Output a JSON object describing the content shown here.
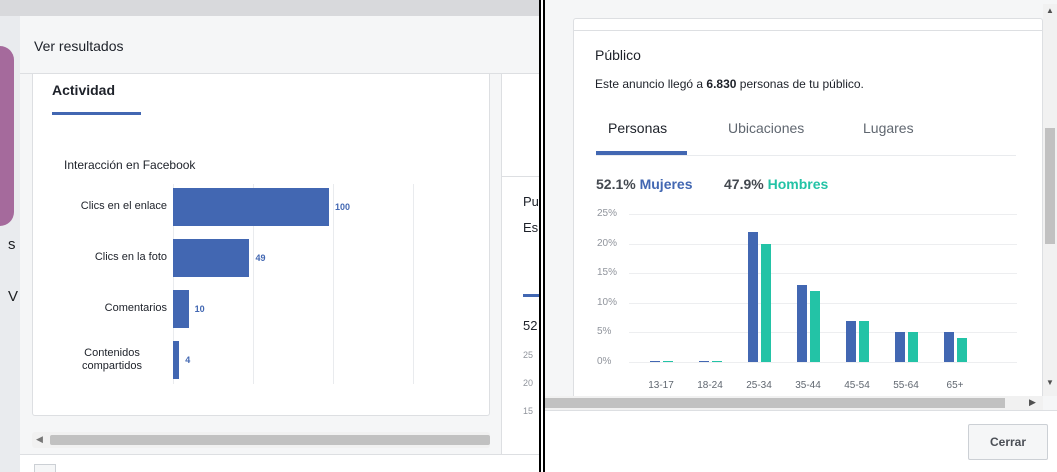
{
  "left": {
    "modal_title": "Ver resultados",
    "tab_label": "Actividad",
    "peek_letters": [
      "s",
      "V",
      "Pu",
      "Es",
      "52",
      "25",
      "20",
      "15"
    ],
    "chart_data": {
      "type": "bar",
      "orientation": "horizontal",
      "title": "Interacción en Facebook",
      "categories": [
        "Clics en el enlace",
        "Clics en la foto",
        "Comentarios",
        "Contenidos compartidos"
      ],
      "values": [
        100,
        49,
        10,
        4
      ],
      "value_labels": [
        "100",
        "49",
        "10",
        "4"
      ],
      "xlim": [
        0,
        150
      ],
      "color": "#4267b2"
    }
  },
  "right": {
    "card_title": "Público",
    "subtitle_prefix": "Este anuncio llegó a ",
    "subtitle_count": "6.830",
    "subtitle_suffix": " personas de tu público.",
    "tabs": [
      {
        "label": "Personas",
        "active": true
      },
      {
        "label": "Ubicaciones",
        "active": false
      },
      {
        "label": "Lugares",
        "active": false
      }
    ],
    "women_pct": "52.1%",
    "women_label": "Mujeres",
    "men_pct": "47.9%",
    "men_label": "Hombres",
    "close_label": "Cerrar",
    "chart_data": {
      "type": "bar",
      "categories": [
        "13-17",
        "18-24",
        "25-34",
        "35-44",
        "45-54",
        "55-64",
        "65+"
      ],
      "series": [
        {
          "name": "Mujeres",
          "color": "#4267b2",
          "values": [
            0.2,
            0.2,
            22,
            13,
            7,
            5,
            5
          ]
        },
        {
          "name": "Hombres",
          "color": "#23c3a6",
          "values": [
            0.2,
            0.2,
            20,
            12,
            7,
            5,
            4
          ]
        }
      ],
      "yticks": [
        "25%",
        "20%",
        "15%",
        "10%",
        "5%",
        "0%"
      ],
      "ylim": [
        0,
        25
      ]
    }
  }
}
